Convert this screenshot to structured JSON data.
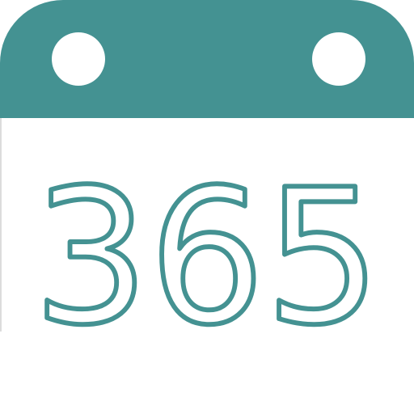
{
  "icon": {
    "day_count": "365",
    "accent_color": "#449292",
    "background_color": "#ffffff",
    "glyph": "calendar-icon"
  }
}
